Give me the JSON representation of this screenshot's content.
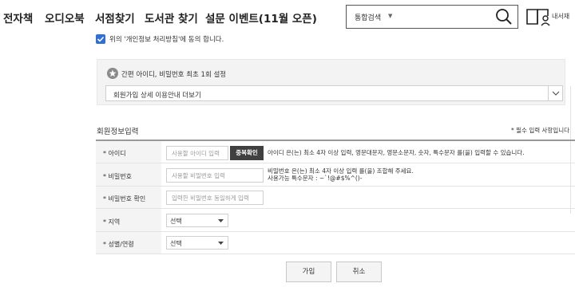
{
  "nav": {
    "items": [
      "전자책",
      "오디오북",
      "서점찾기",
      "도서관 찾기",
      "설문 이벤트(11월 오픈)"
    ],
    "search": {
      "scope": "통합검색",
      "placeholder": ""
    },
    "my_library": "내서재"
  },
  "agreement": {
    "text": "위의 '개인정보 처리방침'에 동의 합니다.",
    "checked": true,
    "accent_color": "#2f6fd6"
  },
  "simple_id": {
    "title": "간편 아이디, 비밀번호 최초 1회 설정",
    "select_value": "회원가입 상세 이용안내 더보기"
  },
  "form": {
    "title": "회원정보입력",
    "required_note": "* 필수 입력 사항입니다",
    "fields": {
      "id": {
        "label": "* 아이디",
        "placeholder": "사용할 아이디 입력",
        "button": "중복확인",
        "hint": "아이디 은(는) 최소 4자 이상 입력, 영문대문자, 영문소문자, 숫자, 특수문자 를(을) 입력할 수 있습니다."
      },
      "password": {
        "label": "* 비밀번호",
        "placeholder": "사용할 비밀번호 입력",
        "hint_line1": "비밀번호 은(는) 최소 4자 이상 입력 를(을) 조합해 주세요.",
        "hint_line2": "사용가능 특수문자 : ~`!@#$%^()-"
      },
      "password_confirm": {
        "label": "* 비밀번호 확인",
        "placeholder": "입력한 비밀번호 동일하게 입력"
      },
      "region": {
        "label": "* 지역",
        "value": "선택"
      },
      "gender_age": {
        "label": "* 성별/연령",
        "value": "선택"
      }
    }
  },
  "buttons": {
    "join": "가입",
    "cancel": "취소"
  }
}
